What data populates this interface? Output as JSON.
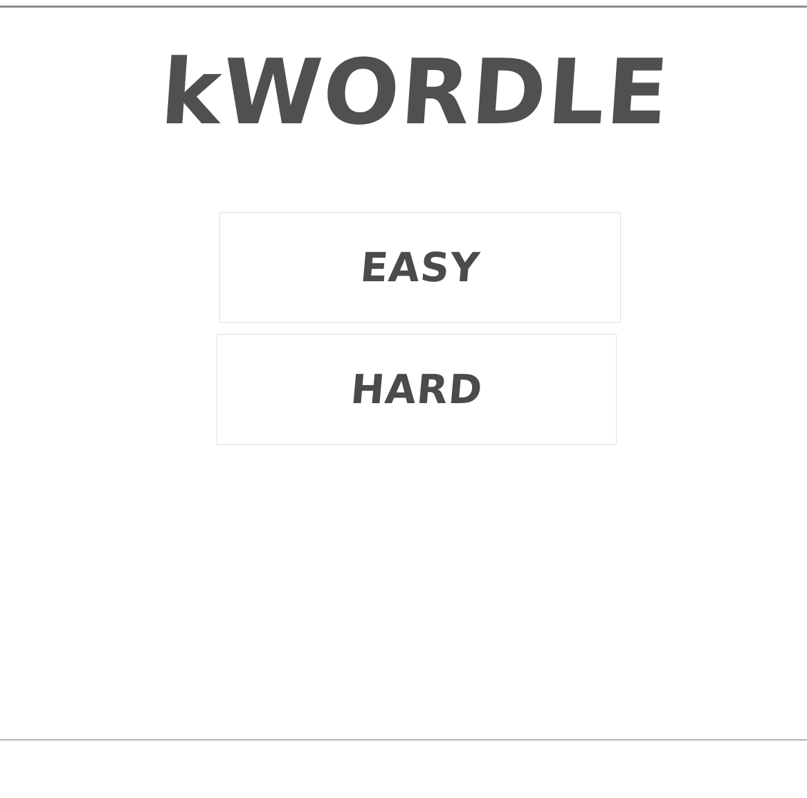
{
  "app": {
    "title": "kWORDLE"
  },
  "menu": {
    "easy_label": "EASY",
    "hard_label": "HARD"
  },
  "colors": {
    "text": "#505050",
    "background": "#ffffff",
    "button_border": "#e1e1e1",
    "frame_line": "#8c8c8c"
  }
}
